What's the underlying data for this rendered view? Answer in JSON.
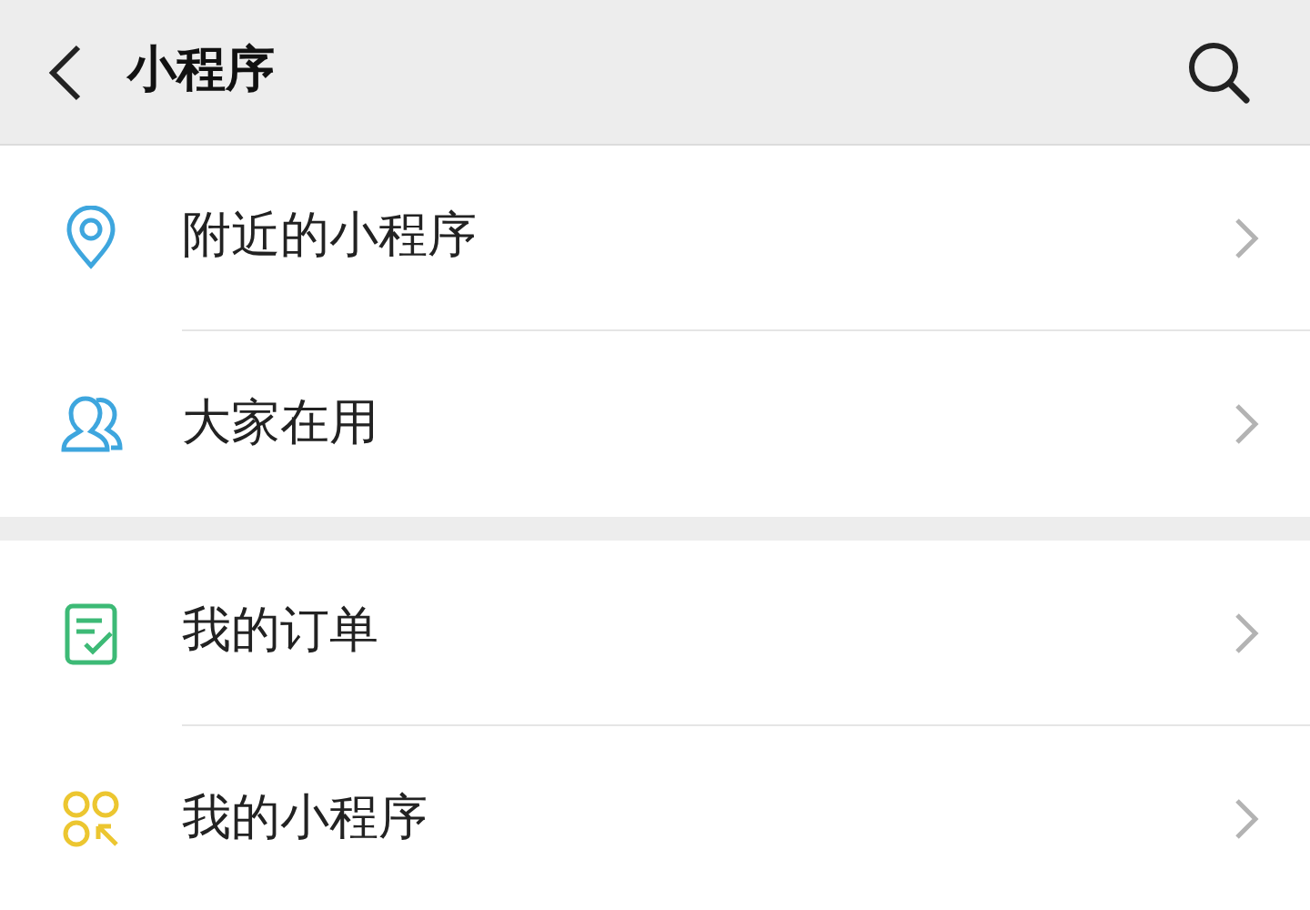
{
  "header": {
    "title": "小程序"
  },
  "groups": [
    {
      "items": [
        {
          "kind": "location",
          "label": "附近的小程序",
          "color": "#3ea6de"
        },
        {
          "kind": "people",
          "label": "大家在用",
          "color": "#3ea6de"
        }
      ]
    },
    {
      "items": [
        {
          "kind": "order",
          "label": "我的订单",
          "color": "#3dba76"
        },
        {
          "kind": "apps",
          "label": "我的小程序",
          "color": "#ecc630"
        }
      ]
    }
  ]
}
